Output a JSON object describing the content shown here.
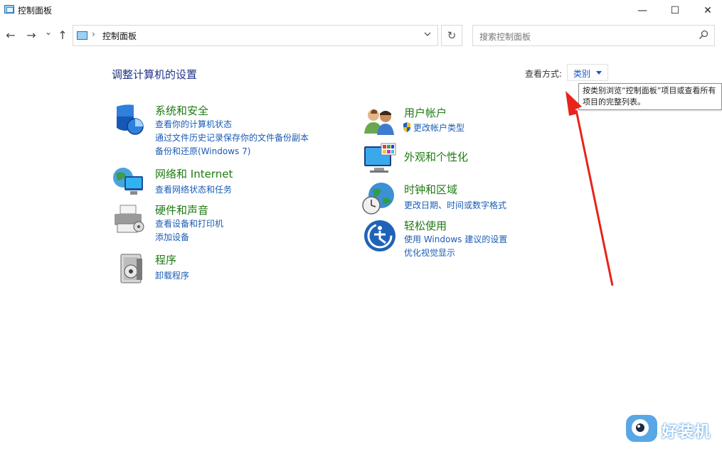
{
  "window": {
    "title": "控制面板",
    "controls": {
      "minimize": "—",
      "maximize": "☐",
      "close": "✕"
    }
  },
  "nav": {
    "back": "←",
    "forward": "→",
    "recent": "⌄",
    "up": "↑",
    "breadcrumb_sep": "›",
    "address": "控制面板",
    "refresh": "↻"
  },
  "search": {
    "placeholder": "搜索控制面板"
  },
  "header": {
    "title": "调整计算机的设置",
    "view_by_label": "查看方式:",
    "view_by_value": "类别"
  },
  "tooltip": {
    "text": "按类别浏览“控制面板”项目或查看所有项目的完整列表。"
  },
  "categories": {
    "left": [
      {
        "title": "系统和安全",
        "icon": "shield-icon",
        "links": [
          "查看你的计算机状态",
          "通过文件历史记录保存你的文件备份副本",
          "备份和还原(Windows 7)"
        ]
      },
      {
        "title": "网络和 Internet",
        "icon": "network-icon",
        "links": [
          "查看网络状态和任务"
        ]
      },
      {
        "title": "硬件和声音",
        "icon": "printer-icon",
        "links": [
          "查看设备和打印机",
          "添加设备"
        ]
      },
      {
        "title": "程序",
        "icon": "programs-icon",
        "links": [
          "卸载程序"
        ]
      }
    ],
    "right": [
      {
        "title": "用户帐户",
        "icon": "users-icon",
        "links": [
          "更改帐户类型"
        ]
      },
      {
        "title": "外观和个性化",
        "icon": "monitor-icon",
        "links": []
      },
      {
        "title": "时钟和区域",
        "icon": "clock-globe-icon",
        "links": [
          "更改日期、时间或数字格式"
        ]
      },
      {
        "title": "轻松使用",
        "icon": "accessibility-icon",
        "links": [
          "使用 Windows 建议的设置",
          "优化视觉显示"
        ]
      }
    ]
  },
  "watermark": {
    "text": "好装机"
  },
  "colors": {
    "category_title": "#1e7a12",
    "link": "#1a5cb5",
    "page_title": "#1e3287",
    "arrow": "#e8231b"
  }
}
